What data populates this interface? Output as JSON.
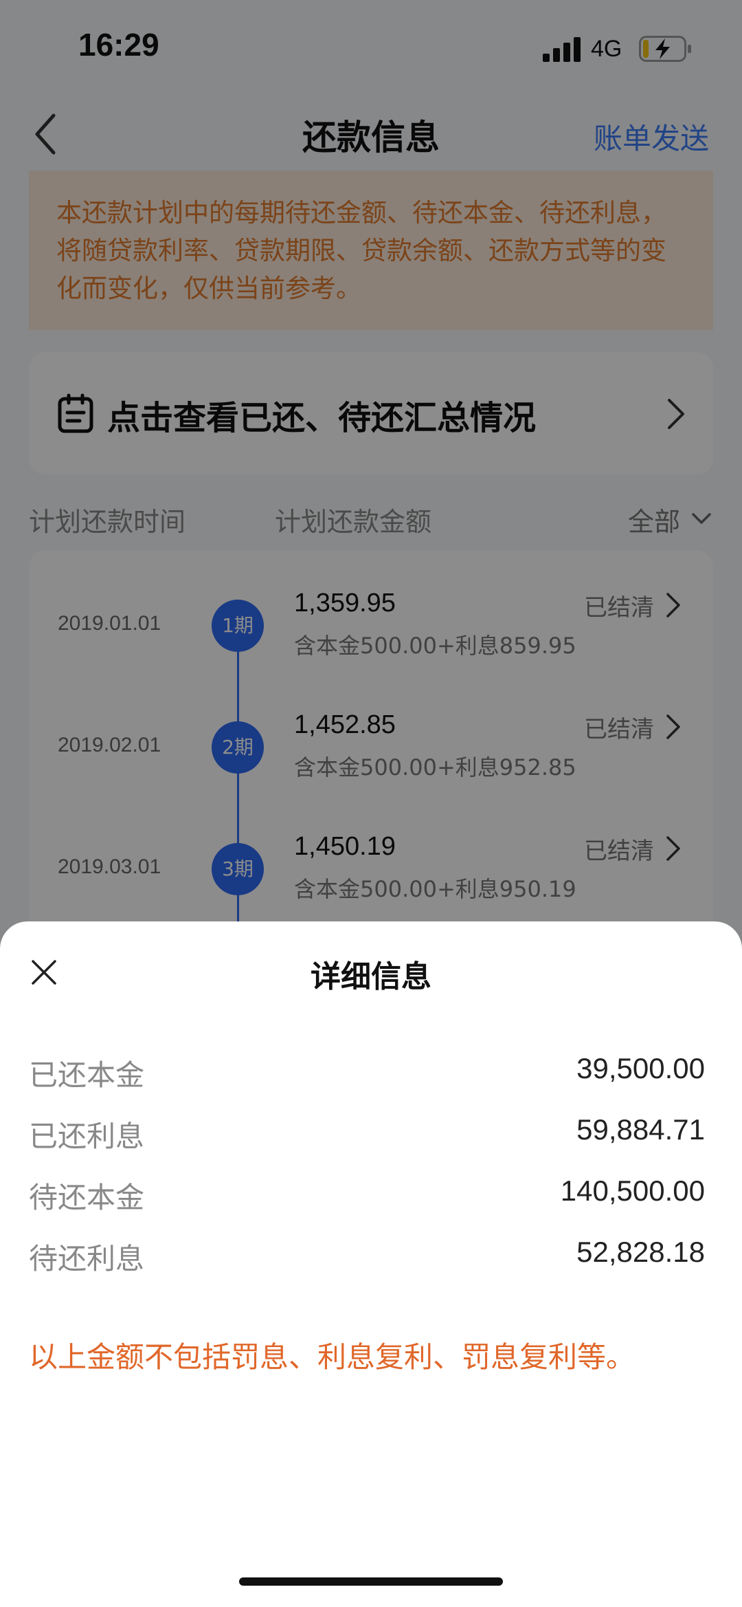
{
  "status_bar": {
    "time": "16:29",
    "network": "4G"
  },
  "nav": {
    "title": "还款信息",
    "bill_send": "账单发送"
  },
  "notice": {
    "text": "本还款计划中的每期待还金额、待还本金、待还利息，将随贷款利率、贷款期限、贷款余额、还款方式等的变化而变化，仅供当前参考。"
  },
  "summary": {
    "label": "点击查看已还、待还汇总情况"
  },
  "table_header": {
    "time": "计划还款时间",
    "amount": "计划还款金额",
    "filter": "全部"
  },
  "plans": [
    {
      "date": "2019.01.01",
      "period": "1期",
      "amount": "1,359.95",
      "breakdown": "含本金500.00+利息859.95",
      "status": "已结清"
    },
    {
      "date": "2019.02.01",
      "period": "2期",
      "amount": "1,452.85",
      "breakdown": "含本金500.00+利息952.85",
      "status": "已结清"
    },
    {
      "date": "2019.03.01",
      "period": "3期",
      "amount": "1,450.19",
      "breakdown": "含本金500.00+利息950.19",
      "status": "已结清"
    }
  ],
  "sheet": {
    "title": "详细信息",
    "details": [
      {
        "label": "已还本金",
        "value": "39,500.00"
      },
      {
        "label": "已还利息",
        "value": "59,884.71"
      },
      {
        "label": "待还本金",
        "value": "140,500.00"
      },
      {
        "label": "待还利息",
        "value": "52,828.18"
      }
    ],
    "note": "以上金额不包括罚息、利息复利、罚息复利等。"
  },
  "colors": {
    "accent_blue": "#2e6bf2",
    "link_blue": "#3f7cf5",
    "notice_orange": "#e07a2e",
    "note_orange": "#e0672a"
  },
  "icons": {
    "back": "back-chevron-icon",
    "clipboard": "clipboard-icon",
    "chevron_right": "chevron-right-icon",
    "chevron_down": "chevron-down-icon",
    "close": "close-icon",
    "signal": "signal-icon",
    "battery": "battery-charging-icon"
  }
}
